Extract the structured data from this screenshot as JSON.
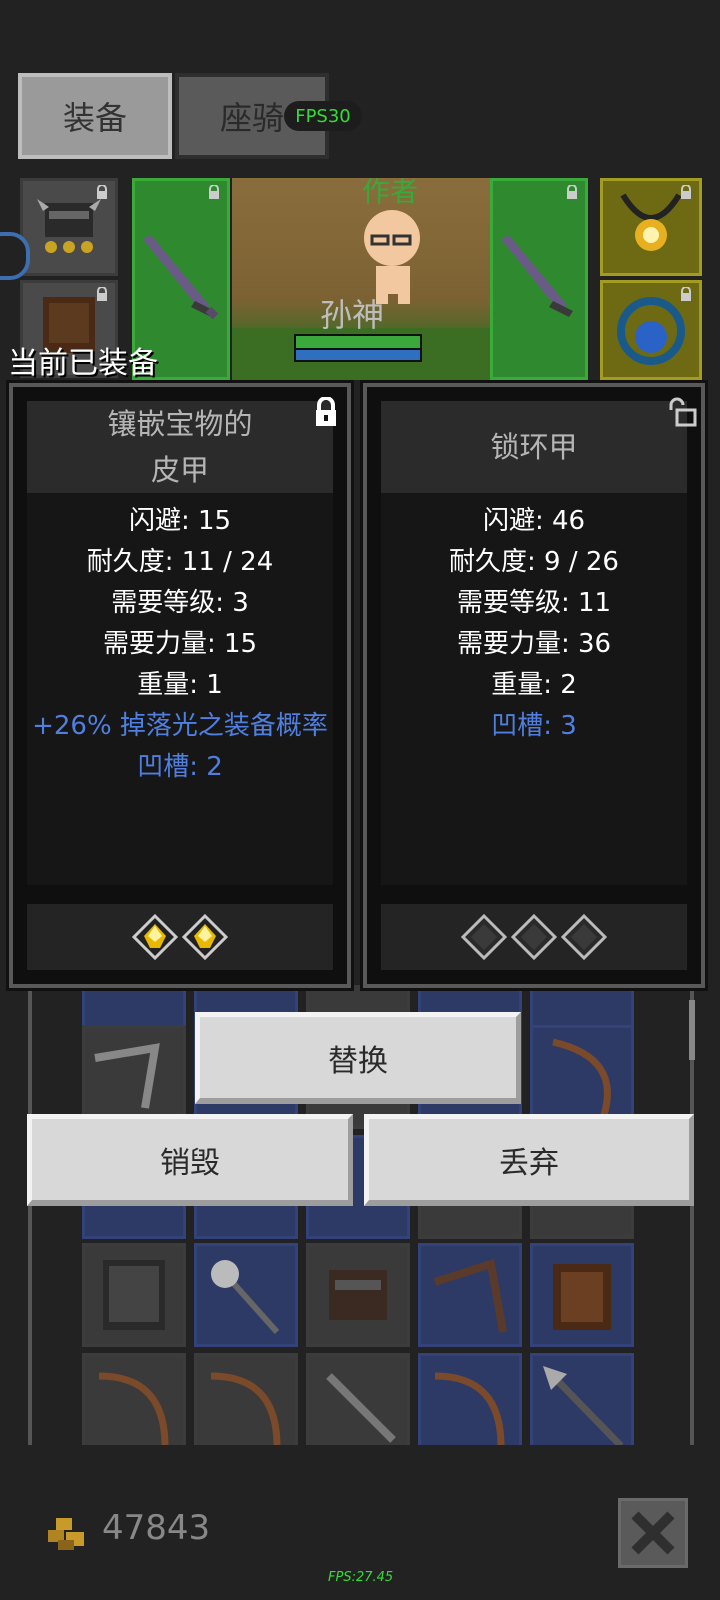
{
  "tabs": {
    "equip_label": "装备",
    "mount_label": "座骑"
  },
  "fps_badge": "FPS30",
  "character": {
    "title": "作者",
    "name": "孙神"
  },
  "equipped_heading": "当前已装备",
  "current_item": {
    "name_line1": "镶嵌宝物的",
    "name_line2": "皮甲",
    "stats": [
      "闪避: 15",
      "耐久度: 11 / 24",
      "需要等级: 3",
      "需要力量: 15",
      "重量: 1"
    ],
    "bonus": "+26% 掉落光之装备概率",
    "sockets_text": "凹槽: 2",
    "sockets_filled": 2,
    "locked": true
  },
  "compare_item": {
    "name": "锁环甲",
    "stats": [
      "闪避: 46",
      "耐久度: 9 / 26",
      "需要等级: 11",
      "需要力量: 36",
      "重量: 2"
    ],
    "sockets_text": "凹槽: 3",
    "sockets_empty": 3,
    "locked": false
  },
  "actions": {
    "replace": "替换",
    "destroy": "销毁",
    "discard": "丢弃"
  },
  "gold": "47843",
  "fps_bottom": "FPS:27.45",
  "colors": {
    "bonus_blue": "#4f7fe0",
    "fps_green": "#33dd33",
    "socket_gold": "#e8b800"
  }
}
